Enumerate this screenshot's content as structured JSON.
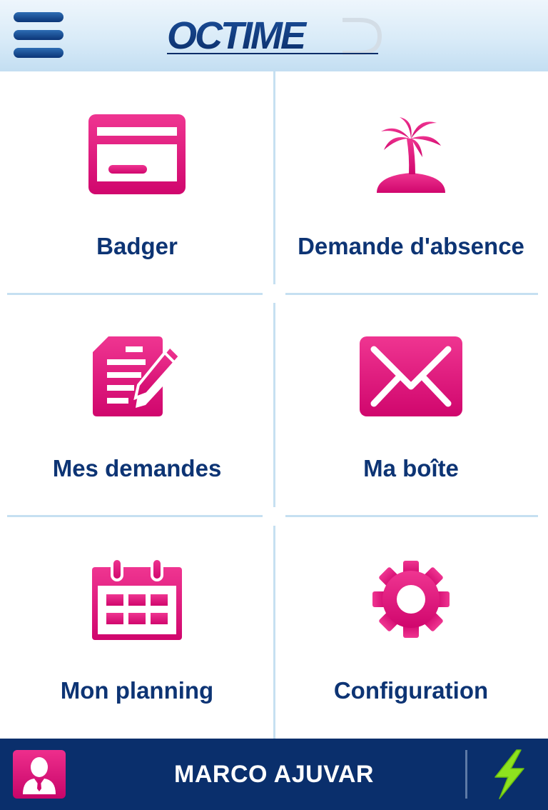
{
  "header": {
    "logo_text": "OCTIME"
  },
  "tiles": [
    {
      "id": "badger",
      "label": "Badger"
    },
    {
      "id": "absence",
      "label": "Demande d'absence"
    },
    {
      "id": "requests",
      "label": "Mes demandes"
    },
    {
      "id": "mailbox",
      "label": "Ma boîte"
    },
    {
      "id": "planning",
      "label": "Mon planning"
    },
    {
      "id": "config",
      "label": "Configuration"
    }
  ],
  "footer": {
    "user_name": "MARCO AJUVAR"
  },
  "colors": {
    "accent": "#e6087a",
    "label": "#0d3474",
    "footer_bg": "#0a2f6c",
    "divider": "#c6e0f1",
    "bolt": "#8ee21f"
  }
}
